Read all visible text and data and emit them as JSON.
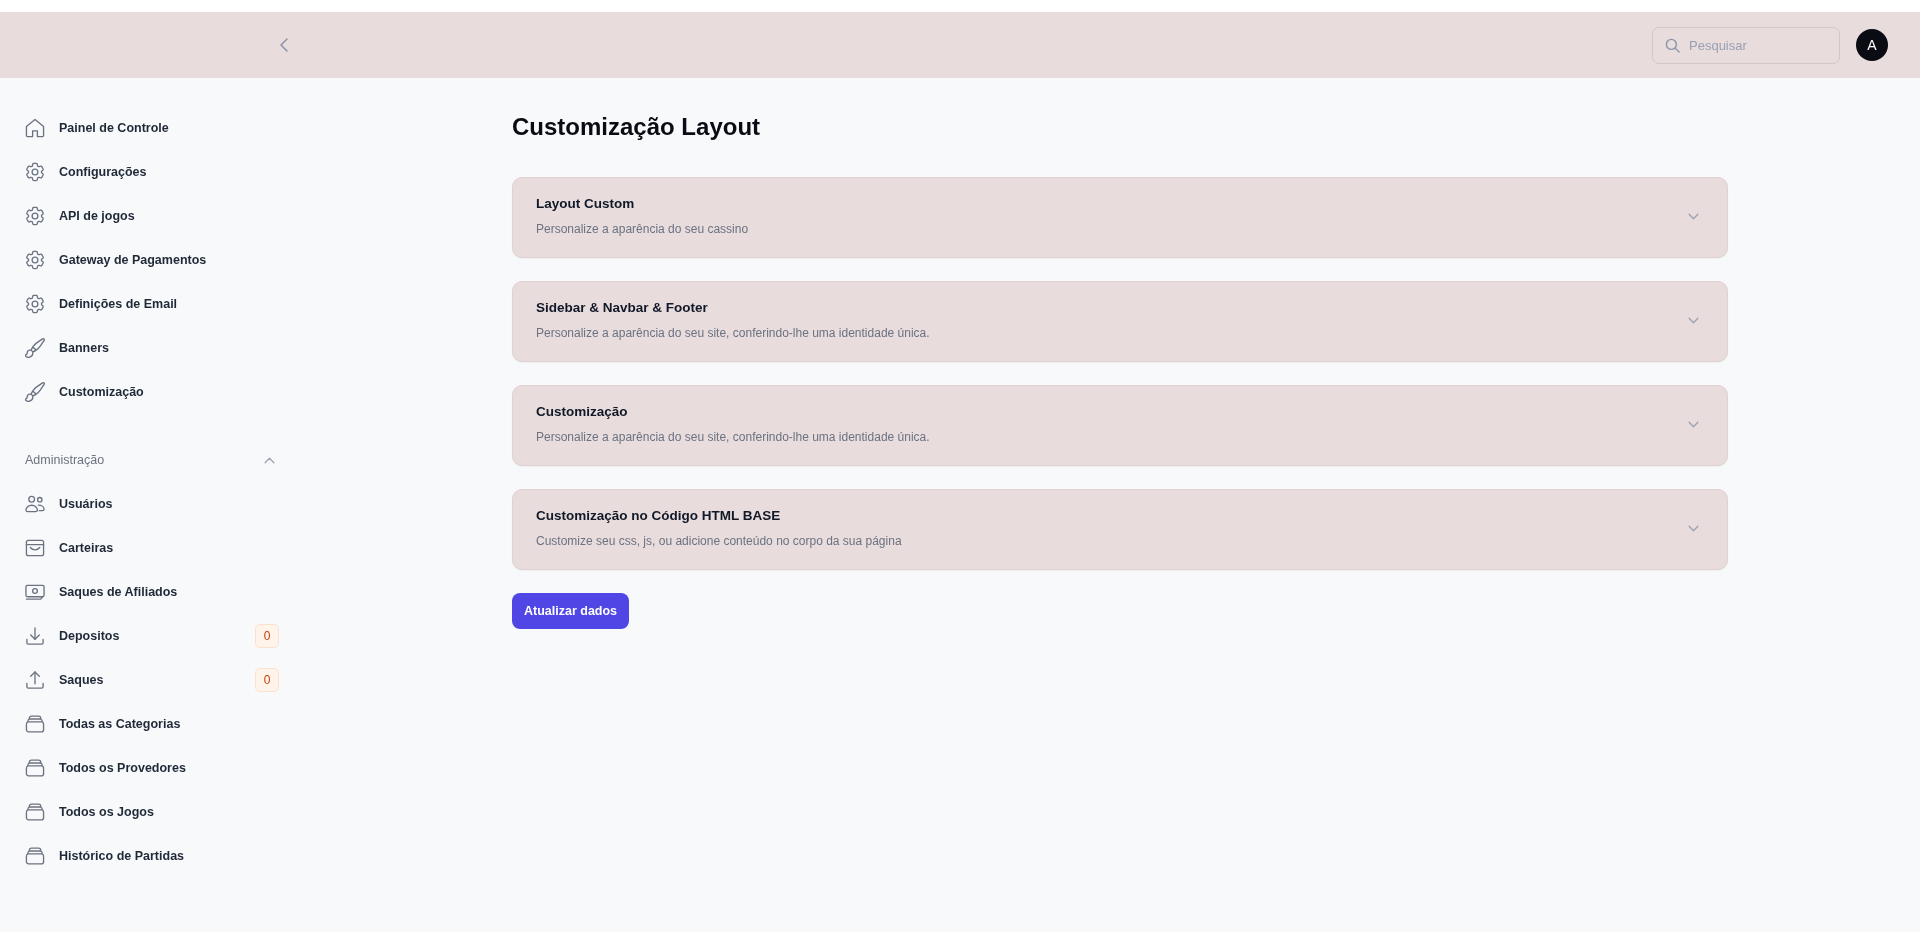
{
  "topbar": {
    "search": {
      "placeholder": "Pesquisar"
    },
    "avatar": {
      "initial": "A"
    }
  },
  "sidebar": {
    "items": [
      {
        "label": "Painel de Controle",
        "kind": "home",
        "selected": false
      },
      {
        "label": "Configurações",
        "kind": "gear",
        "selected": false
      },
      {
        "label": "API de jogos",
        "kind": "gear",
        "selected": false
      },
      {
        "label": "Gateway de Pagamentos",
        "kind": "gear",
        "selected": false
      },
      {
        "label": "Definições de Email",
        "kind": "gear",
        "selected": false
      },
      {
        "label": "Banners",
        "kind": "brush",
        "selected": false
      },
      {
        "label": "Customização",
        "kind": "brush",
        "selected": false
      }
    ],
    "sections": [
      {
        "title": "Administração",
        "expanded": true,
        "items": [
          {
            "label": "Usuários",
            "kind": "users",
            "selected": false
          },
          {
            "label": "Carteiras",
            "kind": "tray",
            "selected": false
          },
          {
            "label": "Saques de Afiliados",
            "kind": "banknote",
            "selected": false
          },
          {
            "label": "Depositos",
            "kind": "download",
            "selected": false,
            "badge": "0"
          },
          {
            "label": "Saques",
            "kind": "upload",
            "selected": false,
            "badge": "0"
          },
          {
            "label": "Todas as Categorias",
            "kind": "stack",
            "selected": false
          },
          {
            "label": "Todos os Provedores",
            "kind": "stack",
            "selected": false
          },
          {
            "label": "Todos os Jogos",
            "kind": "stack",
            "selected": false
          },
          {
            "label": "Histórico de Partidas",
            "kind": "stack",
            "selected": false
          }
        ]
      }
    ]
  },
  "page": {
    "title": "Customização Layout",
    "panels": [
      {
        "title": "Layout Custom",
        "description": "Personalize a aparência do seu cassino",
        "expanded": false
      },
      {
        "title": "Sidebar & Navbar & Footer",
        "description": "Personalize a aparência do seu site, conferindo-lhe uma identidade única.",
        "expanded": false
      },
      {
        "title": "Customização",
        "description": "Personalize a aparência do seu site, conferindo-lhe uma identidade única.",
        "expanded": false
      },
      {
        "title": "Customização no Código HTML BASE",
        "description": "Customize seu css, js, ou adicione conteúdo no corpo da sua página",
        "expanded": false
      }
    ],
    "submit_button": "Atualizar dados"
  }
}
